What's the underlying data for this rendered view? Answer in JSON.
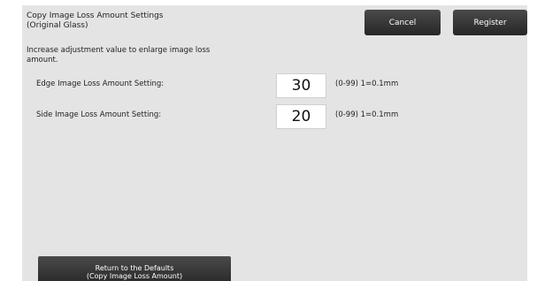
{
  "header": {
    "title": "Copy Image Loss Amount Settings\n(Original Glass)",
    "cancel_label": "Cancel",
    "register_label": "Register"
  },
  "instruction": "Increase adjustment value to enlarge image loss\namount.",
  "settings": [
    {
      "label": "Edge Image Loss Amount Setting:",
      "value": "30",
      "range": "(0-99) 1=0.1mm"
    },
    {
      "label": "Side Image Loss Amount Setting:",
      "value": "20",
      "range": "(0-99) 1=0.1mm"
    }
  ],
  "footer": {
    "defaults_label": "Return to the Defaults\n(Copy Image Loss Amount)"
  },
  "colors": {
    "panel_background": "#e4e4e4",
    "button_dark": "#333333",
    "button_text": "#ffffff"
  }
}
